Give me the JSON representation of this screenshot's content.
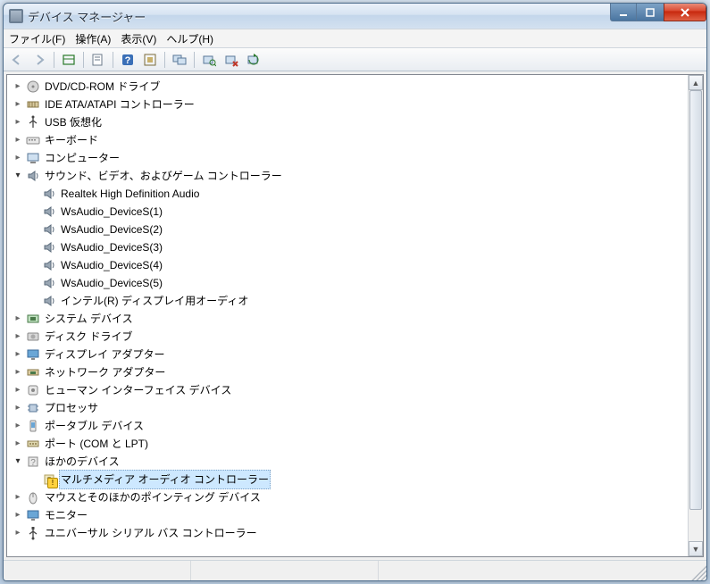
{
  "title": "デバイス マネージャー",
  "menu": {
    "file": "ファイル(F)",
    "action": "操作(A)",
    "view": "表示(V)",
    "help": "ヘルプ(H)"
  },
  "toolbar_icons": {
    "back": "back-arrow-icon",
    "forward": "forward-arrow-icon",
    "show_hidden": "show-hidden-icon",
    "properties": "properties-icon",
    "help": "help-icon",
    "options": "options-icon",
    "remote": "remote-computer-icon",
    "scan": "scan-hardware-icon",
    "uninstall": "uninstall-device-icon",
    "update": "update-driver-icon"
  },
  "tree": [
    {
      "label": "DVD/CD-ROM ドライブ",
      "icon": "disc-drive-icon",
      "expanded": false
    },
    {
      "label": "IDE ATA/ATAPI コントローラー",
      "icon": "ide-controller-icon",
      "expanded": false
    },
    {
      "label": "USB 仮想化",
      "icon": "usb-icon",
      "expanded": false
    },
    {
      "label": "キーボード",
      "icon": "keyboard-icon",
      "expanded": false
    },
    {
      "label": "コンピューター",
      "icon": "computer-icon",
      "expanded": false
    },
    {
      "label": "サウンド、ビデオ、およびゲーム コントローラー",
      "icon": "sound-icon",
      "expanded": true,
      "children": [
        {
          "label": "Realtek High Definition Audio",
          "icon": "sound-icon"
        },
        {
          "label": "WsAudio_DeviceS(1)",
          "icon": "sound-icon"
        },
        {
          "label": "WsAudio_DeviceS(2)",
          "icon": "sound-icon"
        },
        {
          "label": "WsAudio_DeviceS(3)",
          "icon": "sound-icon"
        },
        {
          "label": "WsAudio_DeviceS(4)",
          "icon": "sound-icon"
        },
        {
          "label": "WsAudio_DeviceS(5)",
          "icon": "sound-icon"
        },
        {
          "label": "インテル(R) ディスプレイ用オーディオ",
          "icon": "sound-icon"
        }
      ]
    },
    {
      "label": "システム デバイス",
      "icon": "system-device-icon",
      "expanded": false
    },
    {
      "label": "ディスク ドライブ",
      "icon": "disk-drive-icon",
      "expanded": false
    },
    {
      "label": "ディスプレイ アダプター",
      "icon": "display-adapter-icon",
      "expanded": false
    },
    {
      "label": "ネットワーク アダプター",
      "icon": "network-adapter-icon",
      "expanded": false
    },
    {
      "label": "ヒューマン インターフェイス デバイス",
      "icon": "hid-icon",
      "expanded": false
    },
    {
      "label": "プロセッサ",
      "icon": "processor-icon",
      "expanded": false
    },
    {
      "label": "ポータブル デバイス",
      "icon": "portable-device-icon",
      "expanded": false
    },
    {
      "label": "ポート (COM と LPT)",
      "icon": "port-icon",
      "expanded": false
    },
    {
      "label": "ほかのデバイス",
      "icon": "other-device-icon",
      "expanded": true,
      "children": [
        {
          "label": "マルチメディア オーディオ コントローラー",
          "icon": "unknown-device-icon",
          "warning": true,
          "selected": true
        }
      ]
    },
    {
      "label": "マウスとそのほかのポインティング デバイス",
      "icon": "mouse-icon",
      "expanded": false
    },
    {
      "label": "モニター",
      "icon": "monitor-icon",
      "expanded": false
    },
    {
      "label": "ユニバーサル シリアル バス コントローラー",
      "icon": "usb-controller-icon",
      "expanded": false
    }
  ]
}
